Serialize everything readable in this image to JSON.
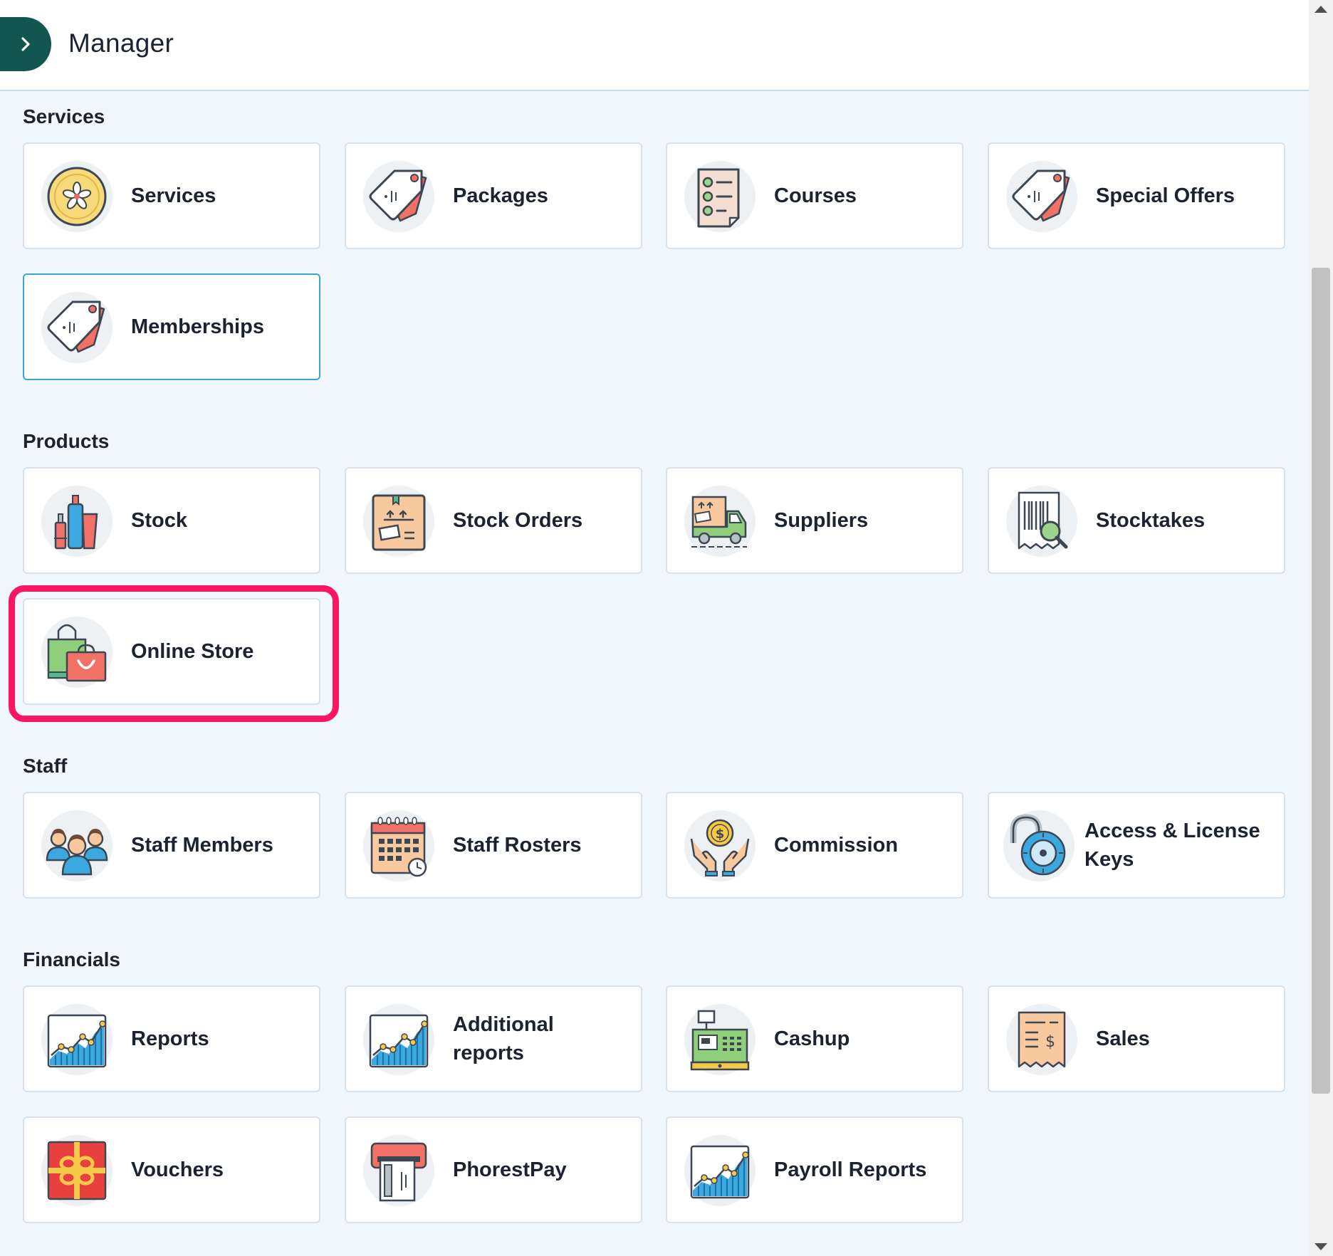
{
  "header": {
    "title": "Manager"
  },
  "sections": [
    {
      "title": "Services",
      "items": [
        {
          "label": "Services",
          "icon": "flower-clock-icon"
        },
        {
          "label": "Packages",
          "icon": "price-tag-icon"
        },
        {
          "label": "Courses",
          "icon": "checklist-icon"
        },
        {
          "label": "Special Offers",
          "icon": "price-tag-icon"
        },
        {
          "label": "Memberships",
          "icon": "price-tag-icon"
        }
      ]
    },
    {
      "title": "Products",
      "items": [
        {
          "label": "Stock",
          "icon": "cosmetics-bottles-icon"
        },
        {
          "label": "Stock Orders",
          "icon": "shipping-box-icon"
        },
        {
          "label": "Suppliers",
          "icon": "delivery-truck-icon"
        },
        {
          "label": "Stocktakes",
          "icon": "barcode-search-icon"
        },
        {
          "label": "Online Store",
          "icon": "shopping-bags-icon"
        }
      ]
    },
    {
      "title": "Staff",
      "items": [
        {
          "label": "Staff Members",
          "icon": "staff-group-icon"
        },
        {
          "label": "Staff Rosters",
          "icon": "calendar-clock-icon"
        },
        {
          "label": "Commission",
          "icon": "hands-coin-icon"
        },
        {
          "label": "Access & License Keys",
          "icon": "combination-lock-icon"
        }
      ]
    },
    {
      "title": "Financials",
      "items": [
        {
          "label": "Reports",
          "icon": "bar-chart-icon"
        },
        {
          "label": "Additional reports",
          "icon": "bar-chart-icon"
        },
        {
          "label": "Cashup",
          "icon": "cash-register-icon"
        },
        {
          "label": "Sales",
          "icon": "receipt-dollar-icon"
        },
        {
          "label": "Vouchers",
          "icon": "gift-voucher-icon"
        },
        {
          "label": "PhorestPay",
          "icon": "card-terminal-icon"
        },
        {
          "label": "Payroll Reports",
          "icon": "bar-chart-icon"
        }
      ]
    }
  ],
  "colors": {
    "brand": "#13554f",
    "highlight": "#fd1565",
    "active_border": "#3aa6d6",
    "content_bg": "#f0f7fd"
  }
}
